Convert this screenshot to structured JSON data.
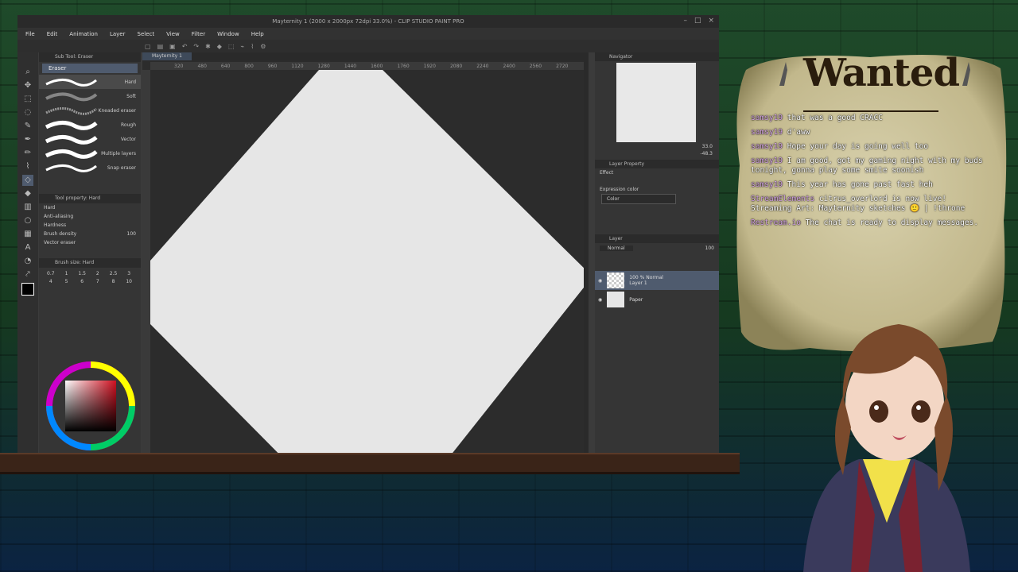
{
  "app": {
    "title": "Mayternity 1 (2000 x 2000px 72dpi 33.0%) - CLIP STUDIO PAINT PRO",
    "menu": [
      "File",
      "Edit",
      "Animation",
      "Layer",
      "Select",
      "View",
      "Filter",
      "Window",
      "Help"
    ],
    "document_tab": "Mayternity 1"
  },
  "sub_tool": {
    "panel_title": "Sub Tool: Eraser",
    "group": "Eraser",
    "brushes": [
      "Hard",
      "Soft",
      "Kneaded eraser",
      "Rough",
      "Vector",
      "Multiple layers",
      "Snap eraser"
    ]
  },
  "tool_property": {
    "panel_title": "Tool property: Hard",
    "preset": "Hard",
    "labels": [
      "Anti-aliasing",
      "Hardness",
      "Brush density",
      "Vector eraser"
    ],
    "brush_density_value": "100"
  },
  "brush_size": {
    "panel_title": "Brush size: Hard",
    "sizes": [
      "0.7",
      "1",
      "1.5",
      "2",
      "2.5",
      "3",
      "4",
      "5",
      "6",
      "7",
      "8",
      "10"
    ]
  },
  "ruler": {
    "ticks": [
      "320",
      "480",
      "640",
      "800",
      "960",
      "1120",
      "1280",
      "1440",
      "1600",
      "1760",
      "1920",
      "2080",
      "2240",
      "2400",
      "2560",
      "2720"
    ]
  },
  "navigator": {
    "title": "Navigator",
    "zoom": "33.0",
    "rotation": "-48.3"
  },
  "layer_property": {
    "title": "Layer Property",
    "effect": "Effect",
    "expression_color_label": "Expression color",
    "expression_color_value": "Color"
  },
  "layer_panel": {
    "title": "Layer",
    "blend_mode": "Normal",
    "opacity": "100",
    "layers": [
      {
        "top": "100 % Normal",
        "name": "Layer 1"
      },
      {
        "top": "",
        "name": "Paper"
      }
    ]
  },
  "overlay": {
    "poster_title": "Wanted",
    "chat": [
      {
        "user": "samsy19",
        "msg": "that was a good CRACC"
      },
      {
        "user": "samsy19",
        "msg": "d'aww"
      },
      {
        "user": "samsy19",
        "msg": "Hope your day is going well too"
      },
      {
        "user": "samsy19",
        "msg": "I am good, got my gaming night with my buds tonight, gonna play some smite soonish"
      },
      {
        "user": "samsy19",
        "msg": "This year has gone past fast heh"
      },
      {
        "user": "StreamElements",
        "msg": "citrus_overlord is now live! Streaming Art: Mayternity sketches 🙂 | !throne"
      },
      {
        "user": "Restream.io",
        "msg": "The chat is ready to display messages."
      }
    ]
  },
  "colors": {
    "accent": "#4f5b6e",
    "canvas": "#e6e6e6",
    "brick_green": "#1f4a2a"
  }
}
